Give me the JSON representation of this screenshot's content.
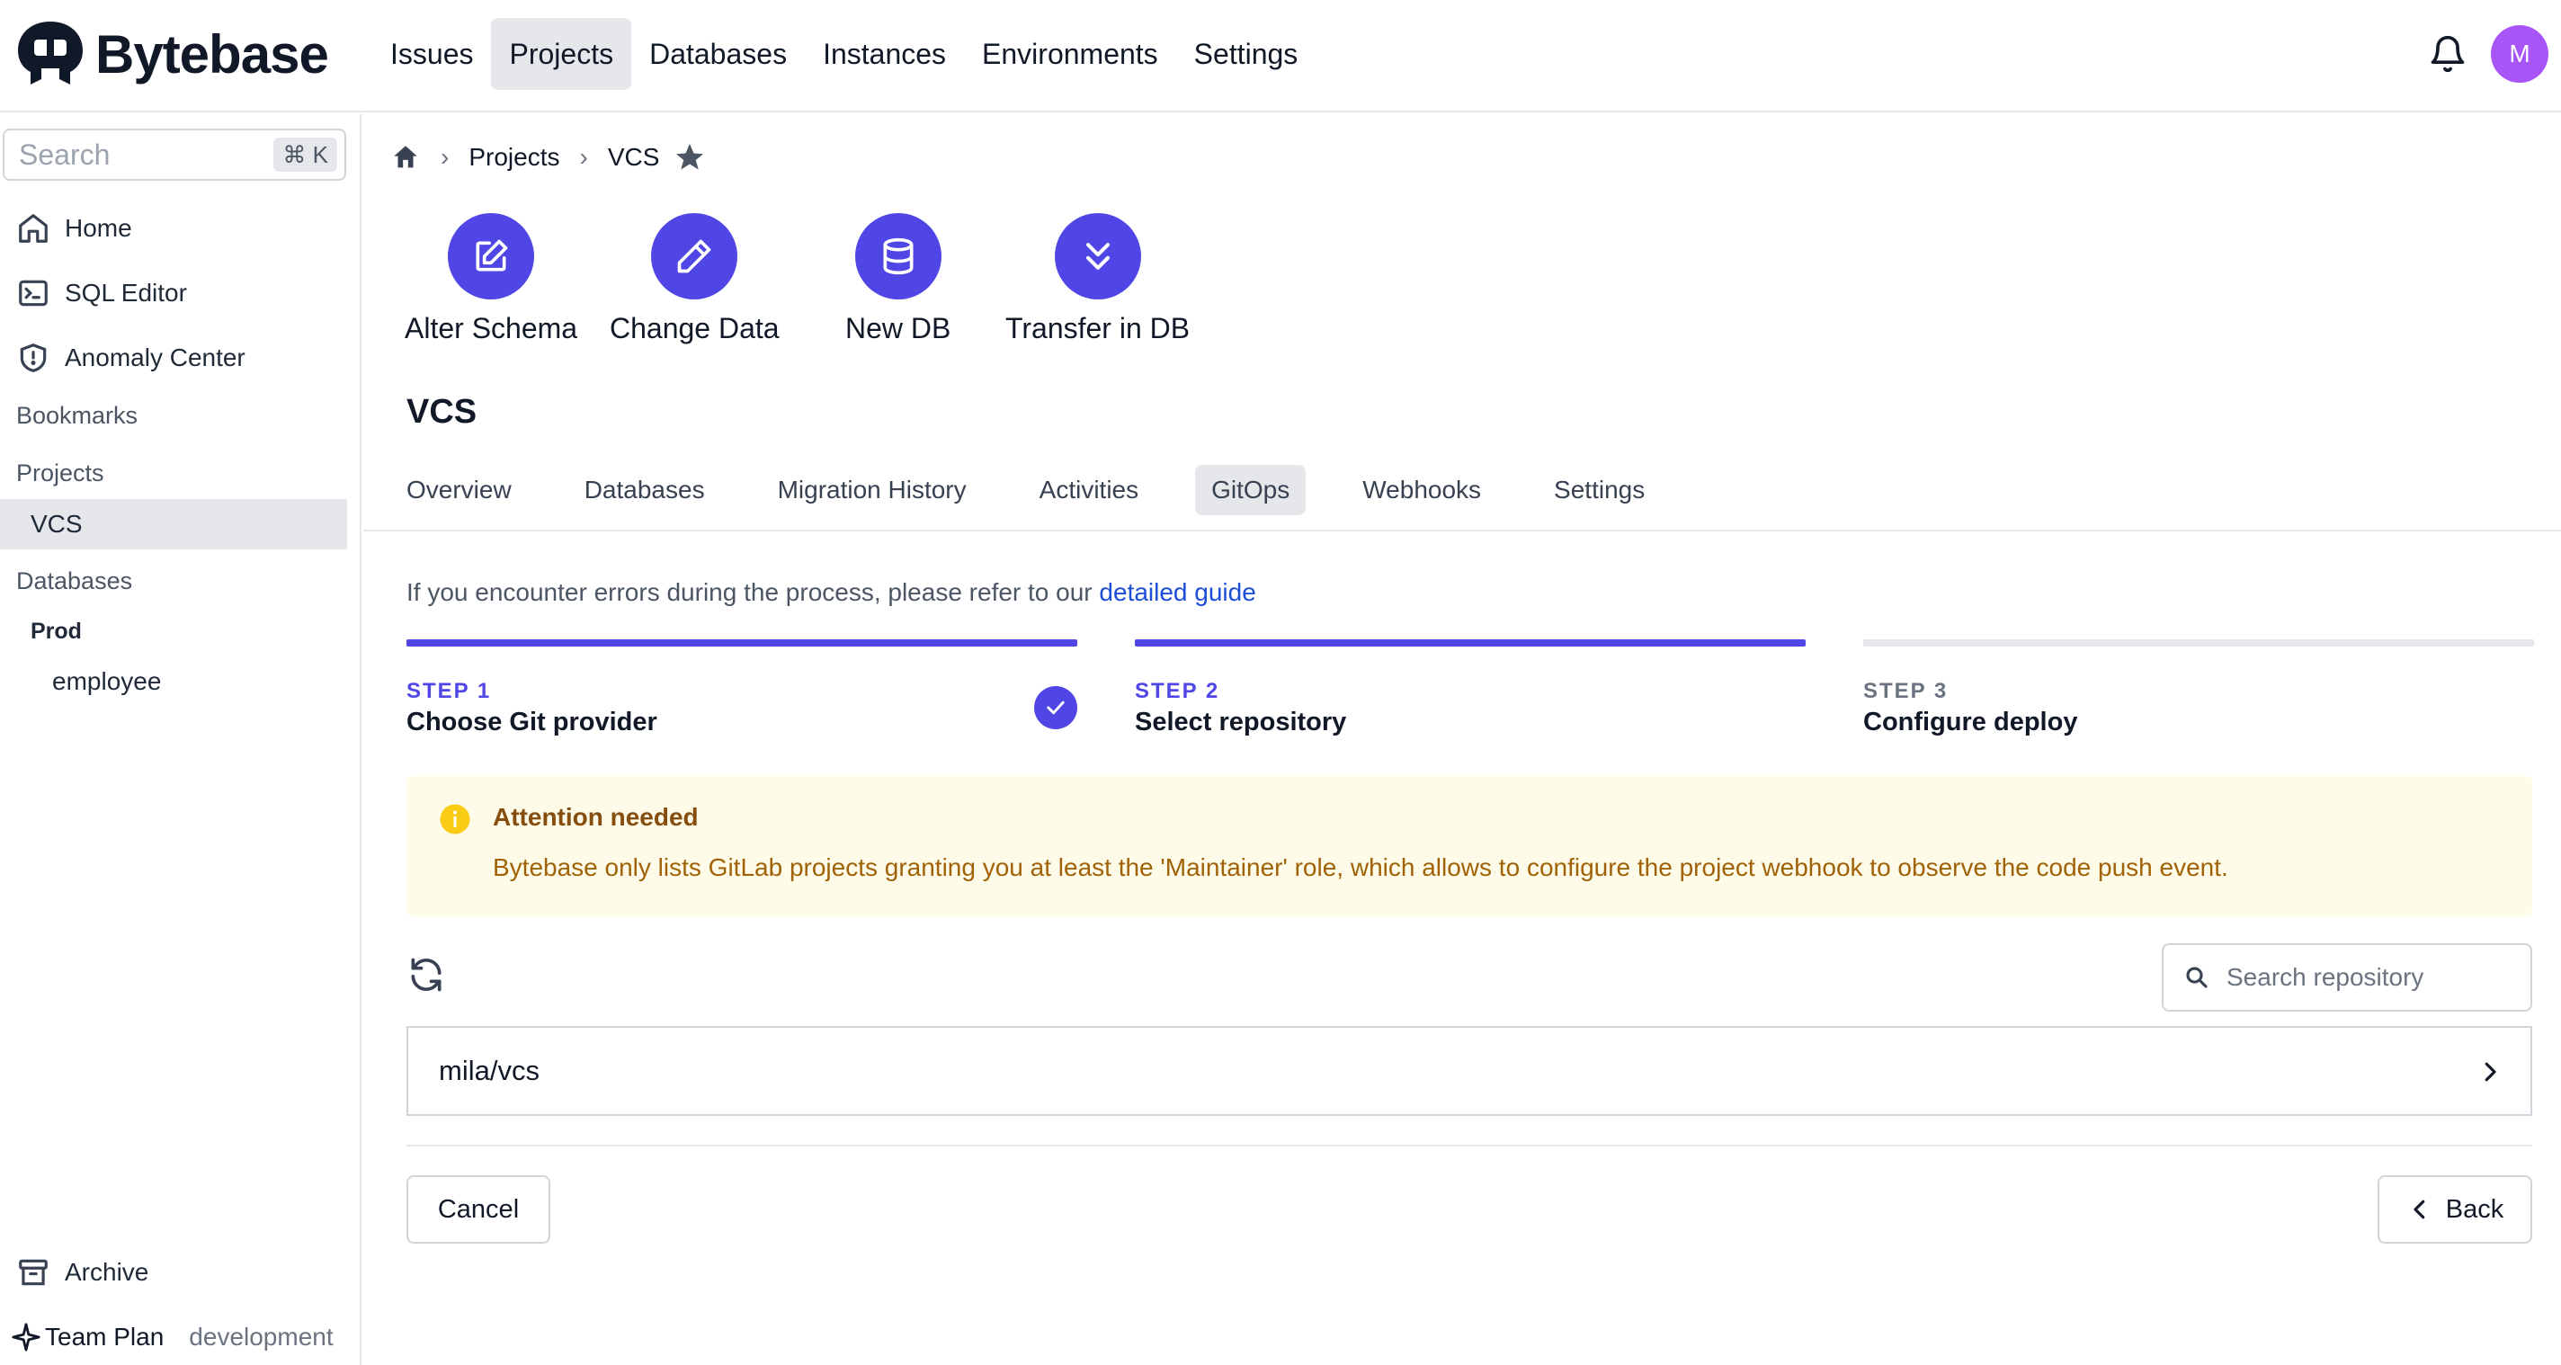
{
  "brand": {
    "name": "Bytebase"
  },
  "nav": {
    "items": [
      "Issues",
      "Projects",
      "Databases",
      "Instances",
      "Environments",
      "Settings"
    ],
    "active": "Projects"
  },
  "user": {
    "initial": "M",
    "avatar_color": "#a855f7"
  },
  "sidebar": {
    "search_placeholder": "Search",
    "shortcut": "⌘ K",
    "items": [
      {
        "label": "Home",
        "icon": "home-icon"
      },
      {
        "label": "SQL Editor",
        "icon": "terminal-icon"
      },
      {
        "label": "Anomaly Center",
        "icon": "shield-icon"
      }
    ],
    "bookmarks_label": "Bookmarks",
    "projects_label": "Projects",
    "project_selected": "VCS",
    "databases_label": "Databases",
    "env_label": "Prod",
    "db_item": "employee",
    "archive_label": "Archive",
    "plan_label": "Team Plan",
    "mode_label": "development"
  },
  "breadcrumb": {
    "projects": "Projects",
    "current": "VCS"
  },
  "quick_actions": [
    {
      "label": "Alter Schema",
      "icon": "edit-icon"
    },
    {
      "label": "Change Data",
      "icon": "pencil-icon"
    },
    {
      "label": "New DB",
      "icon": "database-icon"
    },
    {
      "label": "Transfer in DB",
      "icon": "chevrons-down-icon"
    }
  ],
  "project": {
    "title": "VCS"
  },
  "tabs": [
    "Overview",
    "Databases",
    "Migration History",
    "Activities",
    "GitOps",
    "Webhooks",
    "Settings"
  ],
  "active_tab": "GitOps",
  "guide": {
    "text": "If you encounter errors during the process, please refer to our ",
    "link": "detailed guide"
  },
  "steps": [
    {
      "num": "STEP 1",
      "name": "Choose Git provider",
      "state": "done"
    },
    {
      "num": "STEP 2",
      "name": "Select repository",
      "state": "current"
    },
    {
      "num": "STEP 3",
      "name": "Configure deploy",
      "state": "pending"
    }
  ],
  "alert": {
    "title": "Attention needed",
    "text": "Bytebase only lists GitLab projects granting you at least the 'Maintainer' role, which allows to configure the project webhook to observe the code push event."
  },
  "repo_search": {
    "placeholder": "Search repository"
  },
  "repos": [
    "mila/vcs"
  ],
  "buttons": {
    "cancel": "Cancel",
    "back": "Back"
  },
  "colors": {
    "accent": "#4f46e5",
    "alert_bg": "#fefce8",
    "alert_icon": "#facc15"
  }
}
